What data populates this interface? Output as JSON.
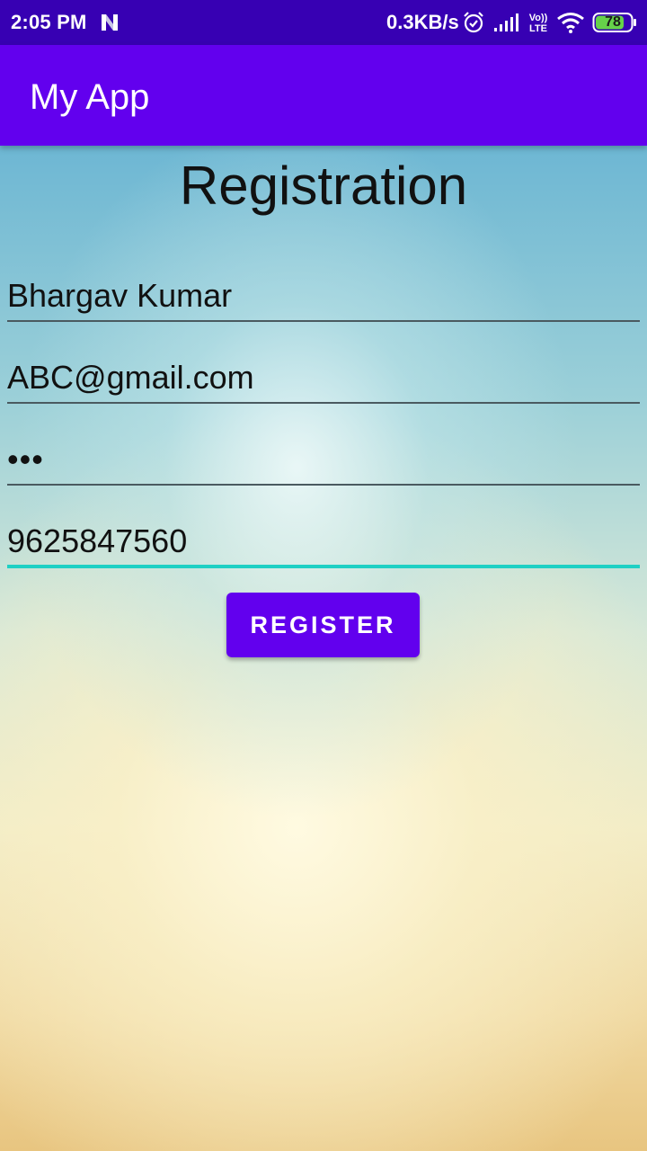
{
  "status_bar": {
    "time": "2:05 PM",
    "network_speed": "0.3KB/s",
    "volte_label_top": "Vo))",
    "volte_label_bottom": "LTE",
    "battery_level": "78",
    "icons": [
      "n-notification-icon",
      "alarm-icon",
      "signal-icon",
      "volte-icon",
      "wifi-icon",
      "battery-icon"
    ]
  },
  "app_bar": {
    "title": "My App",
    "color": "#6200ee"
  },
  "form": {
    "heading": "Registration",
    "fields": [
      {
        "name": "name",
        "value": "Bhargav Kumar"
      },
      {
        "name": "email",
        "value": "ABC@gmail.com"
      },
      {
        "name": "password",
        "value": "•••"
      },
      {
        "name": "phone",
        "value": "9625847560",
        "focused": true
      }
    ],
    "register_label": "REGISTER"
  },
  "colors": {
    "status_bar": "#3700b3",
    "primary": "#6200ee",
    "focus_underline": "#1fd0c4"
  }
}
